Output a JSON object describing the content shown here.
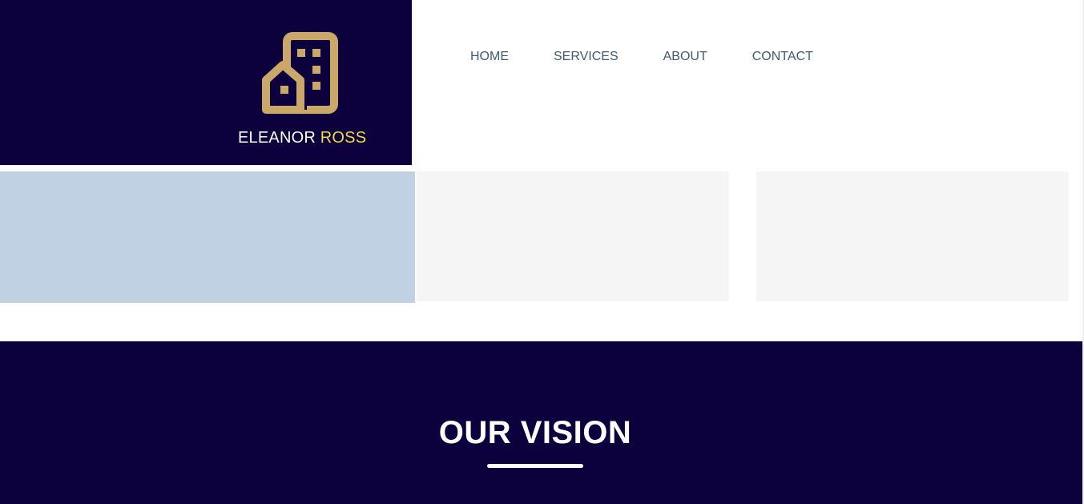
{
  "brand": {
    "logo_icon": "building-icon",
    "name_first": "ELEANOR",
    "name_last": "ROSS",
    "colors": {
      "background": "#0c003d",
      "logo": "#c9a86a",
      "accent": "#f2d84c"
    }
  },
  "nav": {
    "items": [
      {
        "label": "HOME"
      },
      {
        "label": "SERVICES"
      },
      {
        "label": "ABOUT"
      },
      {
        "label": "CONTACT"
      }
    ],
    "color": "#3d5d73"
  },
  "panels": {
    "colors": {
      "primary": "#bfd1e2",
      "secondary": "#f5f5f5"
    }
  },
  "vision": {
    "title": "OUR VISION",
    "background": "#0c003d"
  }
}
